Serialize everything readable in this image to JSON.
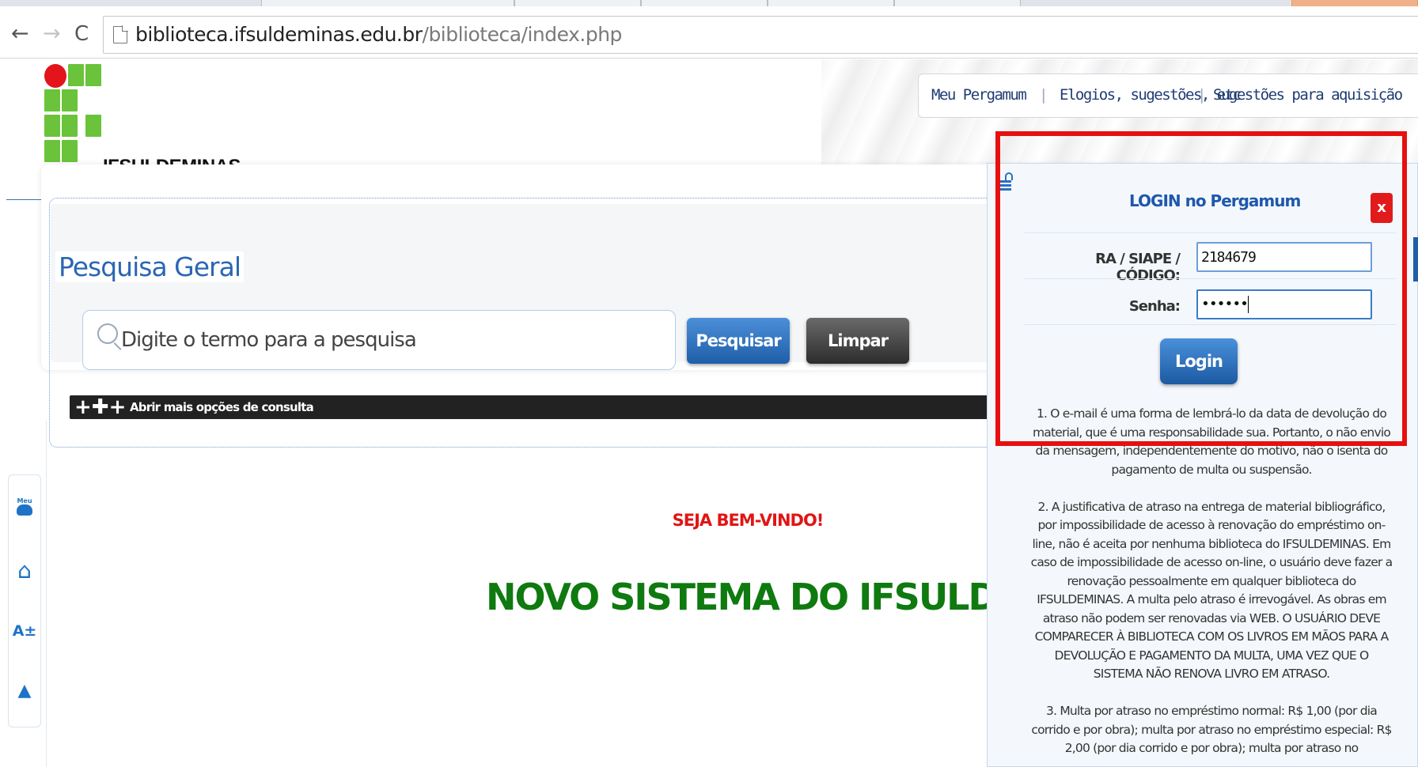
{
  "browser": {
    "url_host": "biblioteca.ifsuldeminas.edu.br",
    "url_path": "/biblioteca/index.php",
    "back_icon": "←",
    "forward_icon": "→",
    "reload_icon": "C"
  },
  "header": {
    "logo_text": "IFSULDEMINAS",
    "links": [
      "Meu Pergamum",
      "Elogios, sugestões, etc",
      "Sugestões para aquisição"
    ],
    "separator": "|"
  },
  "search": {
    "legend": "Pesquisa Geral",
    "placeholder": "Digite o termo para a pesquisa",
    "search_button": "Pesquisar",
    "clear_button": "Limpar",
    "more_options_label": "Abrir mais opções de consulta",
    "more_options_icon": "+✚+"
  },
  "sidebar": {
    "meu_label": "Meu",
    "home_icon": "⌂",
    "font_label": "A±",
    "up_icon": "▲"
  },
  "main": {
    "welcome": "SEJA BEM-VINDO!",
    "headline": "NOVO SISTEMA DO IFSULDEMINA"
  },
  "login": {
    "title": "LOGIN no Pergamum",
    "close_label": "x",
    "user_label": "RA / SIAPE / CÓDIGO:",
    "user_value": "2184679",
    "password_label": "Senha:",
    "password_value": "••••••",
    "login_button": "Login",
    "notes": [
      "1. O e-mail é uma forma de lembrá-lo da data de devolução do material, que é uma responsabilidade sua. Portanto, o não envio da mensagem, independentemente do motivo, não o isenta do pagamento de multa ou suspensão.",
      "2. A justificativa de atraso na entrega de material bibliográfico, por impossibilidade de acesso à renovação do empréstimo on-line, não é aceita por nenhuma biblioteca do IFSULDEMINAS. Em caso de impossibilidade de acesso on-line, o usuário deve fazer a renovação pessoalmente em qualquer biblioteca do IFSULDEMINAS. A multa pelo atraso é irrevogável. As obras em atraso não podem ser renovadas via WEB. O USUÁRIO DEVE COMPARECER À BIBLIOTECA COM OS LIVROS EM MÃOS PARA A DEVOLUÇÃO E PAGAMENTO DA MULTA, UMA VEZ QUE O SISTEMA NÃO RENOVA LIVRO EM ATRASO.",
      "3. Multa por atraso no empréstimo normal: R$ 1,00 (por dia corrido e por obra); multa por atraso no empréstimo especial: R$ 2,00 (por dia corrido e por obra); multa por atraso no"
    ]
  },
  "colors": {
    "highlight": "#e61010",
    "brand_green": "#6ac33a",
    "brand_red": "#e3141b",
    "headline_green": "#0f7a0f",
    "link_blue": "#1f3c72"
  }
}
